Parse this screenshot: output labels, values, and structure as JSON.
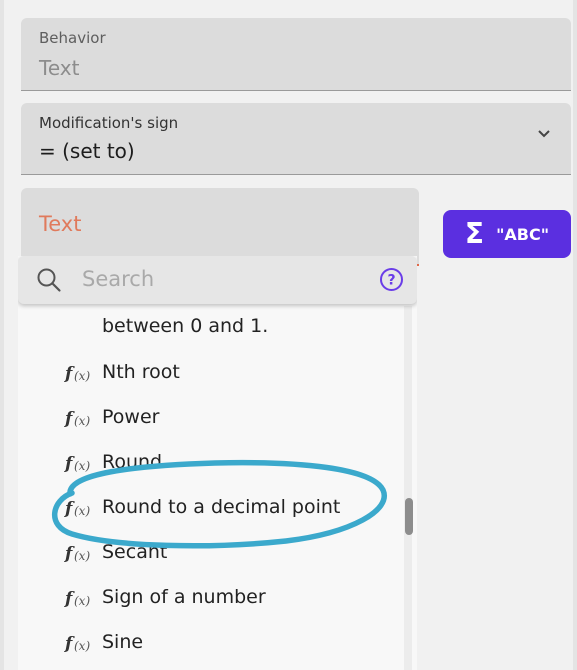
{
  "behavior": {
    "label": "Behavior",
    "value": "Text"
  },
  "sign": {
    "label": "Modification's sign",
    "value": "= (set to)"
  },
  "text_field": {
    "value": "Text"
  },
  "expression_button": {
    "label": "\"ABC\""
  },
  "search": {
    "placeholder": "Search"
  },
  "functions": [
    {
      "label": "between 0 and 1."
    },
    {
      "label": "Nth root"
    },
    {
      "label": "Power"
    },
    {
      "label": "Round"
    },
    {
      "label": "Round to a decimal point"
    },
    {
      "label": "Secant"
    },
    {
      "label": "Sign of a number"
    },
    {
      "label": "Sine"
    }
  ],
  "colors": {
    "accent": "#5b2fe0",
    "error_text": "#e07a5c",
    "highlight_circle": "#3ba9cc"
  }
}
